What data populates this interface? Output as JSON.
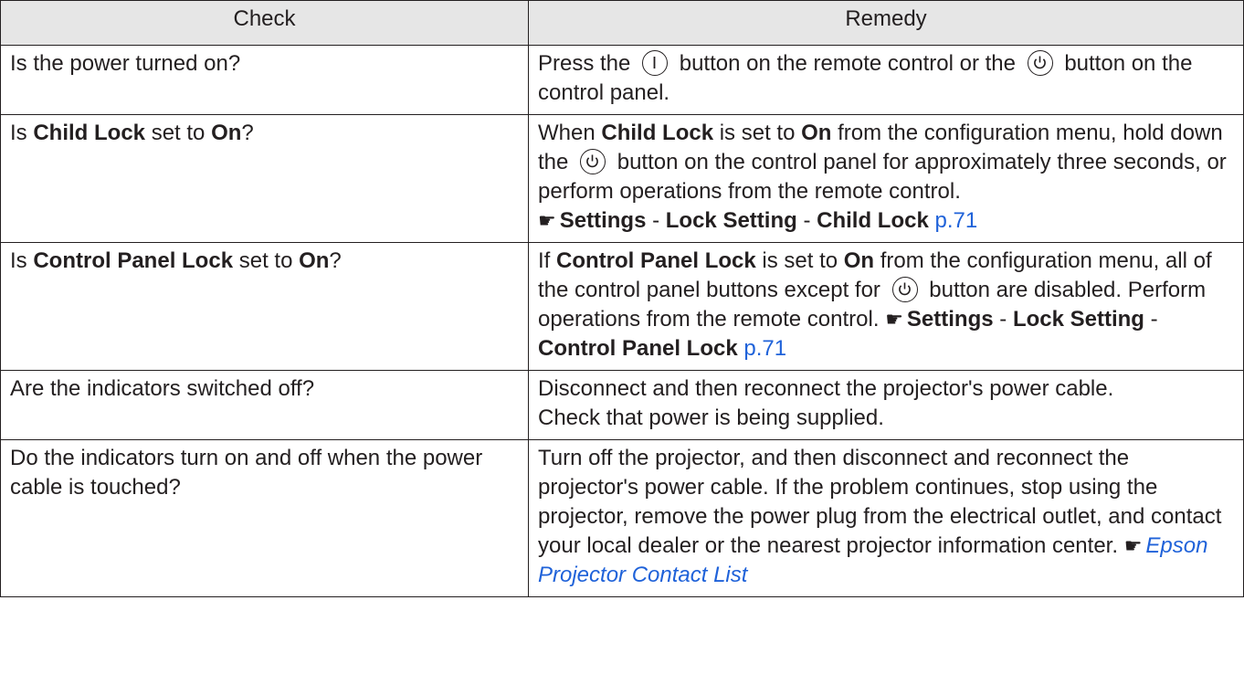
{
  "headers": {
    "check": "Check",
    "remedy": "Remedy"
  },
  "rows": [
    {
      "check": "Is the power turned on?",
      "remedy": {
        "p1": "Press the",
        "p2": "button on the remote control or the",
        "p3": "button on the control panel."
      }
    },
    {
      "check": {
        "pre": "Is",
        "b1": "Child Lock",
        "mid": "set to",
        "b2": "On",
        "post": "?"
      },
      "remedy": {
        "p1": "When",
        "b1": "Child Lock",
        "p2": "is set to",
        "b2": "On",
        "p3": "from the configuration menu, hold down the",
        "p4": "button on the control panel for approximately three seconds, or perform operations from the remote control.",
        "ref": {
          "a": "Settings",
          "sep1": "-",
          "b": "Lock Setting",
          "sep2": "-",
          "c": "Child Lock",
          "page": "p.71"
        }
      }
    },
    {
      "check": {
        "pre": "Is",
        "b1": "Control Panel Lock",
        "mid": "set to",
        "b2": "On",
        "post": "?"
      },
      "remedy": {
        "p1": "If",
        "b1": "Control Panel Lock",
        "p2": "is set to",
        "b2": "On",
        "p3": "from the configuration menu, all of the control panel buttons except for",
        "p4": "button are disa­bled. Perform operations from the remote control.",
        "ref": {
          "a": "Settings",
          "sep1": "-",
          "b": "Lock Setting",
          "sep2": "-",
          "c": "Control Panel Lock",
          "page": "p.71"
        }
      }
    },
    {
      "check": "Are the indicators switched off?",
      "remedy": {
        "l1": "Disconnect and then reconnect the projector's power cable.",
        "l2": "Check that power is being supplied."
      }
    },
    {
      "check": "Do the indicators turn on and off when the power cable is touched?",
      "remedy": {
        "text": "Turn off the projector, and then disconnect and reconnect the projector's power cable. If the problem continues, stop using the projector, remove the power plug from the electrical outlet, and contact your local dealer or the nearest projector information center.",
        "link": "Epson Projector Contact List"
      }
    }
  ],
  "icons": {
    "pointer": "pointing-hand",
    "remote_power": "circled-i-power-button",
    "panel_power": "circled-standby-button"
  },
  "colors": {
    "link": "#1f62d9",
    "header_bg": "#e6e6e6",
    "text": "#231f20"
  }
}
